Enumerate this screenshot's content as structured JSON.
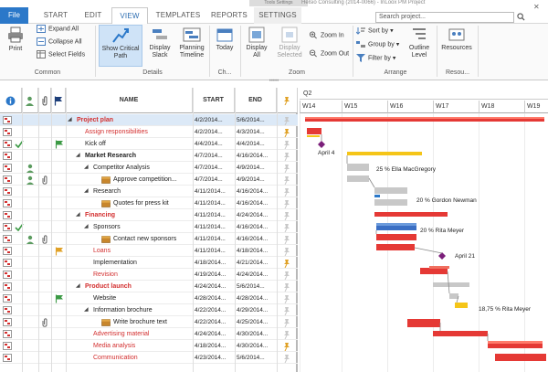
{
  "window": {
    "context_caption": "Tools Settings",
    "title": "Helsio Consulting (2014-0066) - InLoox PM Project",
    "search_placeholder": "Search project..."
  },
  "tabs": [
    {
      "label": "File"
    },
    {
      "label": "START"
    },
    {
      "label": "EDIT"
    },
    {
      "label": "VIEW"
    },
    {
      "label": "TEMPLATES"
    },
    {
      "label": "REPORTS"
    },
    {
      "label": "SETTINGS"
    }
  ],
  "ribbon": {
    "print": "Print",
    "expand_all": "Expand All",
    "collapse_all": "Collapse All",
    "select_fields": "Select Fields",
    "common": "Common",
    "show_critical_path": "Show Critical Path",
    "display_slack": "Display Slack",
    "planning_timeline": "Planning Timeline",
    "details": "Details",
    "today": "Today",
    "ch_group": "Ch...",
    "display_all": "Display All",
    "display_selected": "Display Selected",
    "zoom_in": "Zoom In",
    "zoom_out": "Zoom Out",
    "zoom": "Zoom",
    "sort_by": "Sort by",
    "group_by": "Group by",
    "filter_by": "Filter by",
    "outline_level": "Outline Level",
    "arrange": "Arrange",
    "resources": "Resources",
    "resources_group": "Resou..."
  },
  "grid": {
    "headers": {
      "name": "NAME",
      "start": "START",
      "end": "END"
    },
    "rows": [
      {
        "name": "Project plan",
        "start": "4/2/2014...",
        "end": "5/6/2014...",
        "indent": 0,
        "style": "red",
        "expand": true
      },
      {
        "name": "Assign responsibilities",
        "start": "4/2/2014...",
        "end": "4/3/2014...",
        "indent": 1,
        "style": "red-plain"
      },
      {
        "name": "Kick off",
        "start": "4/4/2014...",
        "end": "4/4/2014...",
        "indent": 1,
        "style": "plain"
      },
      {
        "name": "Market Research",
        "start": "4/7/2014...",
        "end": "4/16/2014...",
        "indent": 1,
        "style": "bold",
        "expand": true
      },
      {
        "name": "Competitor Analysis",
        "start": "4/7/2014...",
        "end": "4/9/2014...",
        "indent": 2,
        "style": "plain",
        "expand": true
      },
      {
        "name": "Approve competition...",
        "start": "4/7/2014...",
        "end": "4/9/2014...",
        "indent": 3,
        "style": "plain"
      },
      {
        "name": "Research",
        "start": "4/11/2014...",
        "end": "4/16/2014...",
        "indent": 2,
        "style": "plain",
        "expand": true
      },
      {
        "name": "Quotes for press kit",
        "start": "4/11/2014...",
        "end": "4/16/2014...",
        "indent": 3,
        "style": "plain"
      },
      {
        "name": "Financing",
        "start": "4/11/2014...",
        "end": "4/24/2014...",
        "indent": 1,
        "style": "red",
        "expand": true
      },
      {
        "name": "Sponsors",
        "start": "4/11/2014...",
        "end": "4/16/2014...",
        "indent": 2,
        "style": "plain",
        "expand": true
      },
      {
        "name": "Contact new sponsors",
        "start": "4/11/2014...",
        "end": "4/16/2014...",
        "indent": 3,
        "style": "plain"
      },
      {
        "name": "Loans",
        "start": "4/11/2014...",
        "end": "4/18/2014...",
        "indent": 2,
        "style": "red-plain"
      },
      {
        "name": "Implementation",
        "start": "4/18/2014...",
        "end": "4/21/2014...",
        "indent": 2,
        "style": "plain"
      },
      {
        "name": "Revision",
        "start": "4/19/2014...",
        "end": "4/24/2014...",
        "indent": 2,
        "style": "red-plain"
      },
      {
        "name": "Product launch",
        "start": "4/24/2014...",
        "end": "5/6/2014...",
        "indent": 1,
        "style": "red",
        "expand": true
      },
      {
        "name": "Website",
        "start": "4/28/2014...",
        "end": "4/28/2014...",
        "indent": 2,
        "style": "plain"
      },
      {
        "name": "Information brochure",
        "start": "4/22/2014...",
        "end": "4/29/2014...",
        "indent": 2,
        "style": "plain",
        "expand": true
      },
      {
        "name": "Write brochure text",
        "start": "4/22/2014...",
        "end": "4/25/2014...",
        "indent": 3,
        "style": "plain"
      },
      {
        "name": "Advertising material",
        "start": "4/24/2014...",
        "end": "4/30/2014...",
        "indent": 2,
        "style": "red-plain"
      },
      {
        "name": "Media analysis",
        "start": "4/18/2014...",
        "end": "4/30/2014...",
        "indent": 2,
        "style": "red-plain"
      },
      {
        "name": "Communication",
        "start": "4/23/2014...",
        "end": "5/6/2014...",
        "indent": 2,
        "style": "red-plain"
      }
    ]
  },
  "gantt": {
    "quarter": "Q2",
    "weeks": [
      "W14",
      "W15",
      "W16",
      "W17",
      "W18",
      "W19"
    ],
    "labels": {
      "april4": "April 4",
      "ella": "25 % Ella MacGregory",
      "gordon": "20 % Gordon Newman",
      "rita1": "20 % Rita Meyer",
      "april21": "April 21",
      "rita2": "18,75 % Rita Meyer"
    }
  },
  "colors": {
    "accent": "#2b78c9",
    "critical": "#e53935",
    "progress": "#f5c518",
    "summary_red": "#d32f2f",
    "baseline": "#c8c8c8",
    "milestone": "#7b1f7a"
  }
}
